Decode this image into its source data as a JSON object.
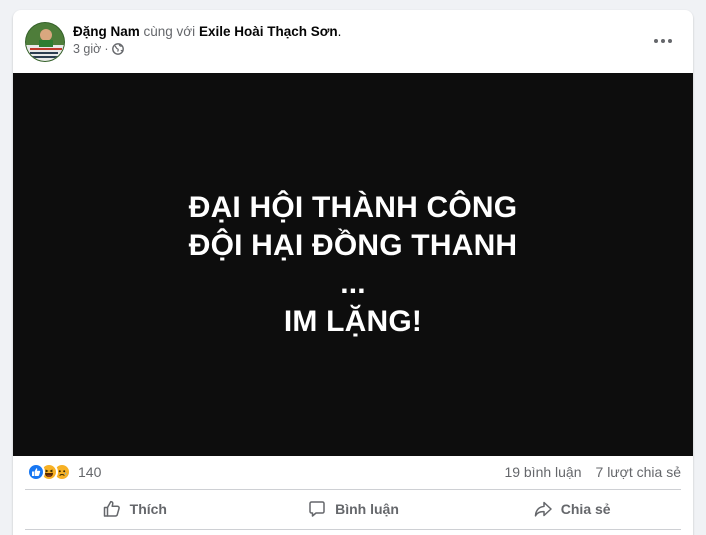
{
  "post": {
    "author": "Đặng Nam",
    "with_text": "cùng với",
    "tagged": "Exile Hoài Thạch Sơn",
    "tagged_suffix": ".",
    "time": "3 giờ",
    "dot": "·",
    "privacy_icon": "globe-icon",
    "more_icon": "more-horizontal-icon"
  },
  "media": {
    "lines": [
      "ĐẠI HỘI THÀNH CÔNG",
      "ĐỘI HẠI ĐỒNG THANH",
      "...",
      "IM LẶNG!"
    ],
    "background": "#0d0d0d"
  },
  "stats": {
    "reactions": [
      "like",
      "haha",
      "sad"
    ],
    "reaction_count": "140",
    "comments": "19 bình luận",
    "shares": "7 lượt chia sẻ"
  },
  "actions": {
    "like": "Thích",
    "comment": "Bình luận",
    "share": "Chia sẻ"
  },
  "colors": {
    "like_blue": "#1877f2",
    "reaction_yellow": "#f7b125",
    "secondary_text": "#65676b"
  }
}
